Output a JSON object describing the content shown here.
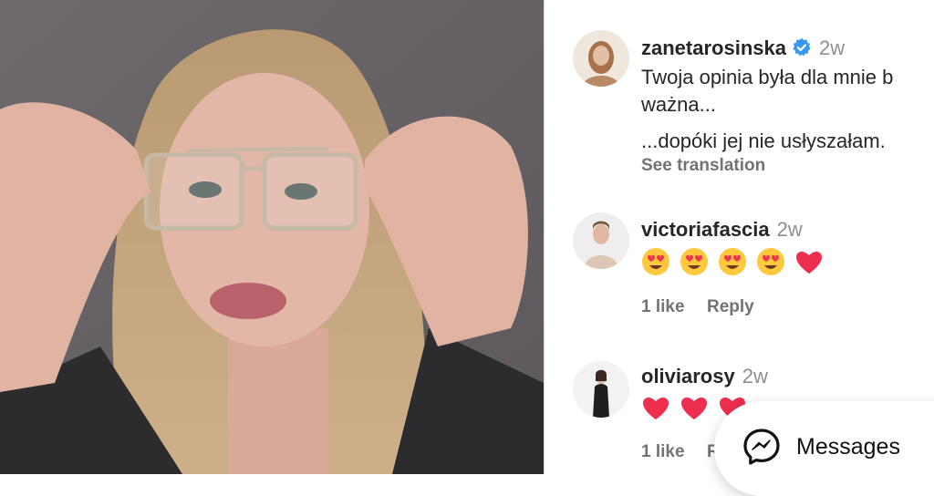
{
  "post": {
    "username": "zanetarosinska",
    "time": "2w",
    "caption_line1": "Twoja opinia była dla mnie b",
    "caption_line2": "ważna...",
    "caption_line3": "...dopóki jej nie usłyszałam.",
    "see_translation": "See translation"
  },
  "comments": [
    {
      "username": "victoriafascia",
      "time": "2w",
      "emojis": [
        "heart-eyes-emoji",
        "heart-eyes-emoji",
        "heart-eyes-emoji",
        "heart-eyes-emoji",
        "red-heart-emoji"
      ],
      "likes": "1 like",
      "reply": "Reply"
    },
    {
      "username": "oliviarosy",
      "time": "2w",
      "emojis": [
        "red-heart-emoji",
        "red-heart-emoji",
        "red-heart-emoji"
      ],
      "likes": "1 like",
      "reply": "Reply"
    }
  ],
  "messages_button": {
    "label": "Messages",
    "icon": "messenger-icon"
  },
  "colors": {
    "verified_blue": "#3897f0",
    "heart_red": "#ed2e4f",
    "text_muted": "#737373"
  }
}
